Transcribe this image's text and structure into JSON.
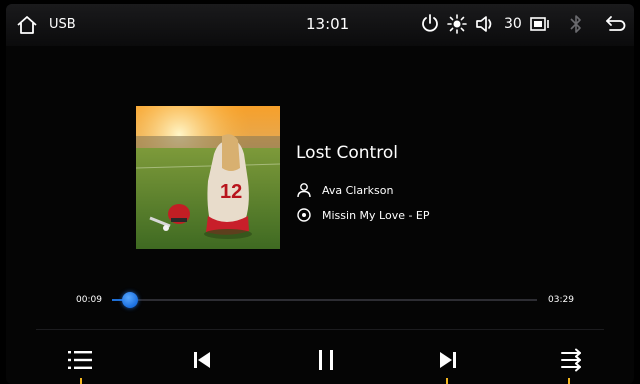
{
  "topbar": {
    "source_label": "USB",
    "clock": "13:01",
    "volume": "30"
  },
  "track": {
    "title": "Lost Control",
    "artist": "Ava Clarkson",
    "album": "Missin My Love - EP",
    "jersey_number": "12"
  },
  "progress": {
    "current": "00:09",
    "total": "03:29",
    "fraction": 0.043
  },
  "colors": {
    "accent_blue": "#1e6fd6",
    "accent_yellow": "#f3b61f",
    "background": "#050505"
  },
  "icons": {
    "home": "home-icon",
    "power": "power-icon",
    "brightness": "brightness-icon",
    "volume": "volume-icon",
    "display": "display-mode-icon",
    "bluetooth": "bluetooth-icon",
    "back": "back-icon",
    "playlist": "playlist-icon",
    "previous": "previous-track-icon",
    "pause": "pause-icon",
    "next": "next-track-icon",
    "shuffle": "shuffle-icon"
  }
}
